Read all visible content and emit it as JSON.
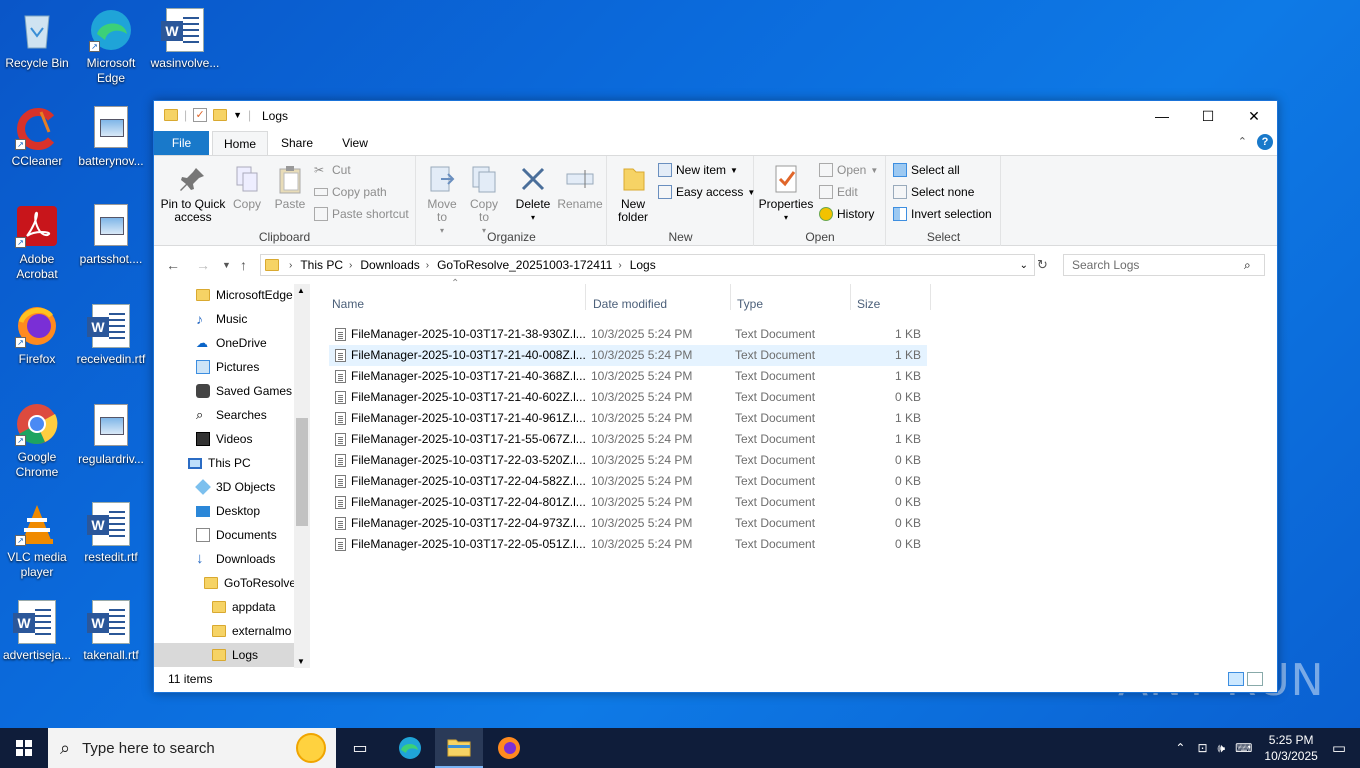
{
  "desktop": {
    "icons": [
      {
        "label": "Recycle Bin"
      },
      {
        "label": "Microsoft Edge"
      },
      {
        "label": "wasinvolve..."
      },
      {
        "label": "CCleaner"
      },
      {
        "label": "batterynov..."
      },
      {
        "label": "Adobe Acrobat"
      },
      {
        "label": "partsshot...."
      },
      {
        "label": "Firefox"
      },
      {
        "label": "receivedin.rtf"
      },
      {
        "label": "Google Chrome"
      },
      {
        "label": "regulardriv..."
      },
      {
        "label": "VLC media player"
      },
      {
        "label": "restedit.rtf"
      },
      {
        "label": "advertiseja..."
      },
      {
        "label": "takenall.rtf"
      }
    ],
    "watermark": "ANY RUN"
  },
  "window": {
    "title": "Logs",
    "tabs": {
      "file": "File",
      "home": "Home",
      "share": "Share",
      "view": "View"
    },
    "ribbon": {
      "clipboard": {
        "label": "Clipboard",
        "pin": "Pin to Quick access",
        "copy": "Copy",
        "paste": "Paste",
        "cut": "Cut",
        "copy_path": "Copy path",
        "paste_shortcut": "Paste shortcut"
      },
      "organize": {
        "label": "Organize",
        "move_to": "Move to",
        "copy_to": "Copy to",
        "delete": "Delete",
        "rename": "Rename"
      },
      "new": {
        "label": "New",
        "new_folder": "New folder",
        "new_item": "New item",
        "easy_access": "Easy access"
      },
      "open": {
        "label": "Open",
        "properties": "Properties",
        "open": "Open",
        "edit": "Edit",
        "history": "History"
      },
      "select": {
        "label": "Select",
        "select_all": "Select all",
        "select_none": "Select none",
        "invert": "Invert selection"
      }
    },
    "address": {
      "crumbs": [
        "This PC",
        "Downloads",
        "GoToResolve_20251003-172411",
        "Logs"
      ],
      "search_placeholder": "Search Logs"
    },
    "nav": [
      {
        "label": "MicrosoftEdge"
      },
      {
        "label": "Music"
      },
      {
        "label": "OneDrive"
      },
      {
        "label": "Pictures"
      },
      {
        "label": "Saved Games"
      },
      {
        "label": "Searches"
      },
      {
        "label": "Videos"
      },
      {
        "label": "This PC"
      },
      {
        "label": "3D Objects"
      },
      {
        "label": "Desktop"
      },
      {
        "label": "Documents"
      },
      {
        "label": "Downloads"
      },
      {
        "label": "GoToResolve_"
      },
      {
        "label": "appdata"
      },
      {
        "label": "externalmo"
      },
      {
        "label": "Logs"
      }
    ],
    "columns": {
      "name": "Name",
      "date": "Date modified",
      "type": "Type",
      "size": "Size"
    },
    "files": [
      {
        "name": "FileManager-2025-10-03T17-21-38-930Z.l...",
        "date": "10/3/2025 5:24 PM",
        "type": "Text Document",
        "size": "1 KB"
      },
      {
        "name": "FileManager-2025-10-03T17-21-40-008Z.l...",
        "date": "10/3/2025 5:24 PM",
        "type": "Text Document",
        "size": "1 KB"
      },
      {
        "name": "FileManager-2025-10-03T17-21-40-368Z.l...",
        "date": "10/3/2025 5:24 PM",
        "type": "Text Document",
        "size": "1 KB"
      },
      {
        "name": "FileManager-2025-10-03T17-21-40-602Z.l...",
        "date": "10/3/2025 5:24 PM",
        "type": "Text Document",
        "size": "0 KB"
      },
      {
        "name": "FileManager-2025-10-03T17-21-40-961Z.l...",
        "date": "10/3/2025 5:24 PM",
        "type": "Text Document",
        "size": "1 KB"
      },
      {
        "name": "FileManager-2025-10-03T17-21-55-067Z.l...",
        "date": "10/3/2025 5:24 PM",
        "type": "Text Document",
        "size": "1 KB"
      },
      {
        "name": "FileManager-2025-10-03T17-22-03-520Z.l...",
        "date": "10/3/2025 5:24 PM",
        "type": "Text Document",
        "size": "0 KB"
      },
      {
        "name": "FileManager-2025-10-03T17-22-04-582Z.l...",
        "date": "10/3/2025 5:24 PM",
        "type": "Text Document",
        "size": "0 KB"
      },
      {
        "name": "FileManager-2025-10-03T17-22-04-801Z.l...",
        "date": "10/3/2025 5:24 PM",
        "type": "Text Document",
        "size": "0 KB"
      },
      {
        "name": "FileManager-2025-10-03T17-22-04-973Z.l...",
        "date": "10/3/2025 5:24 PM",
        "type": "Text Document",
        "size": "0 KB"
      },
      {
        "name": "FileManager-2025-10-03T17-22-05-051Z.l...",
        "date": "10/3/2025 5:24 PM",
        "type": "Text Document",
        "size": "0 KB"
      }
    ],
    "status": "11 items"
  },
  "taskbar": {
    "search_placeholder": "Type here to search",
    "time": "5:25 PM",
    "date": "10/3/2025"
  },
  "colors": {
    "accent": "#1979ca",
    "taskbar": "#0f1d3a",
    "row_highlight": "#e5f3ff",
    "desktop": "#0b6bdc"
  }
}
